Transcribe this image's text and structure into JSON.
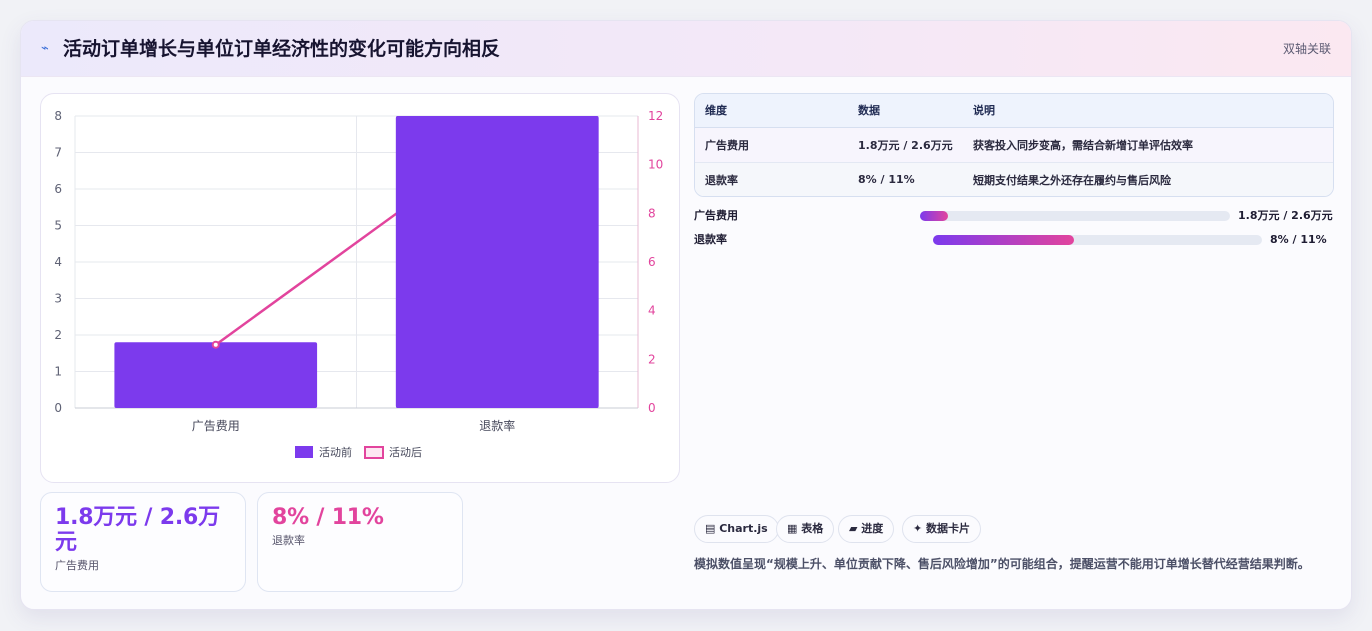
{
  "header": {
    "icon": "sparkline-icon",
    "title": "活动订单增长与单位订单经济性的变化可能方向相反",
    "badge": "双轴关联"
  },
  "chart_data": {
    "type": "bar",
    "categories": [
      "广告费用",
      "退款率"
    ],
    "series": [
      {
        "name": "活动前",
        "type": "bar",
        "axis": "left",
        "color": "#7c3aed",
        "values": [
          1.8,
          8
        ]
      },
      {
        "name": "活动后",
        "type": "line",
        "axis": "right",
        "color": "#e2449d",
        "values": [
          2.6,
          11
        ]
      }
    ],
    "y_left": {
      "ticks": [
        "0",
        "1",
        "2",
        "3",
        "4",
        "5",
        "6",
        "7",
        "8"
      ],
      "ylim": [
        0,
        8
      ]
    },
    "y_right": {
      "ticks": [
        "0",
        "2",
        "4",
        "6",
        "8",
        "10",
        "12"
      ],
      "ylim": [
        0,
        12
      ]
    },
    "grid": true,
    "legend": "bottom"
  },
  "kpis": [
    {
      "value": "1.8万元 / 2.6万元",
      "label": "广告费用",
      "color": "#7c3aed"
    },
    {
      "value": "8% / 11%",
      "label": "退款率",
      "color": "#e2449d"
    }
  ],
  "table": {
    "headers": [
      "维度",
      "数据",
      "说明"
    ],
    "rows": [
      [
        "广告费用",
        "1.8万元 / 2.6万元",
        "获客投入同步变高，需结合新增订单评估效率"
      ],
      [
        "退款率",
        "8% / 11%",
        "短期支付结果之外还存在履约与售后风险"
      ]
    ]
  },
  "progress": [
    {
      "label": "广告费用",
      "value": "1.8万元 / 2.6万元",
      "fraction": 0.09
    },
    {
      "label": "退款率",
      "value": "8% / 11%",
      "fraction": 0.43
    }
  ],
  "chips": [
    "▤ Chart.js",
    "▦ 表格",
    "▰ 进度",
    "✦ 数据卡片"
  ],
  "note": "模拟数值呈现“规模上升、单位贡献下降、售后风险增加”的可能组合，提醒运营不能用订单增长替代经营结果判断。"
}
